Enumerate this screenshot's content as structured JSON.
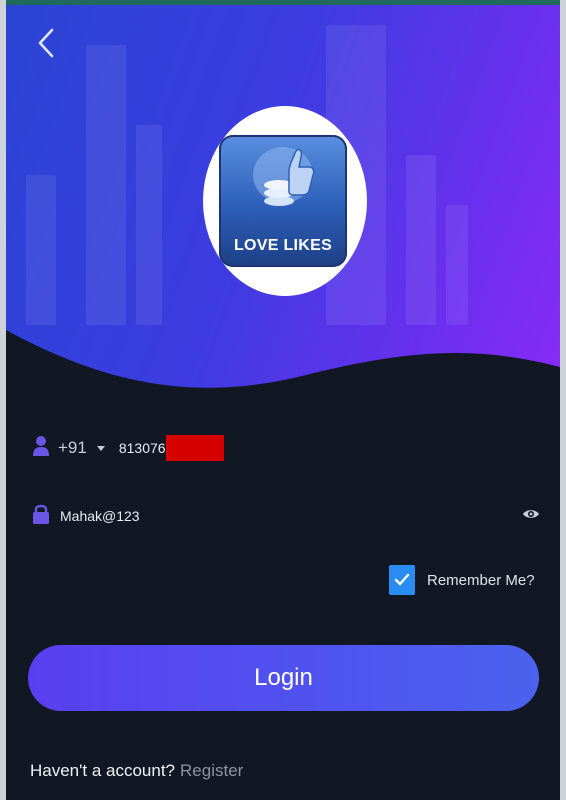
{
  "logo": {
    "text": "LOVE LIKES",
    "icon": "thumbs-up-coins-icon"
  },
  "phone": {
    "country_code": "+91",
    "number_visible": "813076",
    "redacted": true
  },
  "password": {
    "value": "Mahak@123"
  },
  "remember": {
    "label": "Remember Me?",
    "checked": true
  },
  "login": {
    "label": "Login"
  },
  "footer": {
    "question": "Haven't a account?",
    "register_label": "Register"
  },
  "colors": {
    "accent": "#4f54ef",
    "checkbox": "#2a8cf0",
    "background": "#121724",
    "redaction": "#d70000"
  },
  "icons": {
    "back": "chevron-left-icon",
    "user": "user-icon",
    "lock": "lock-icon",
    "visibility": "eye-icon",
    "check": "check-icon"
  }
}
